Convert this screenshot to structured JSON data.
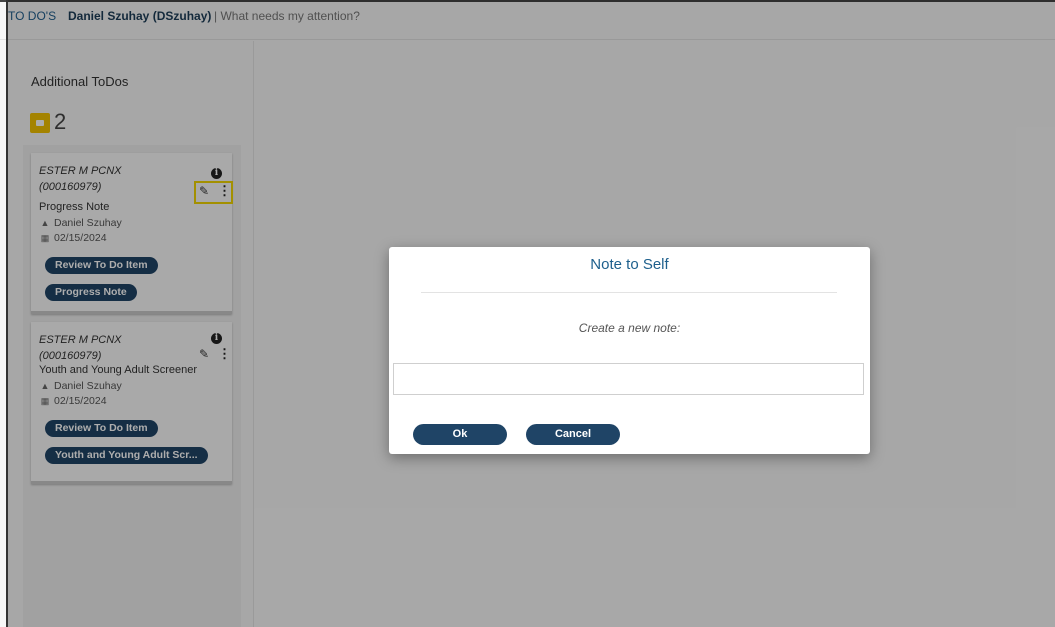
{
  "header": {
    "section": "TO DO'S",
    "user": "Daniel Szuhay (DSzuhay)",
    "subtitle": "| What needs my attention?"
  },
  "sidebar": {
    "heading": "Additional ToDos",
    "folder_count": "2",
    "cards": [
      {
        "client_name": "ESTER M PCNX",
        "client_id": "(000160979)",
        "item_type": "Progress Note",
        "user_icon": "user-icon",
        "user": "Daniel Szuhay",
        "date_icon": "calendar-icon",
        "date": "02/15/2024",
        "buttons": [
          "Review To Do Item",
          "Progress Note"
        ]
      },
      {
        "client_name": "ESTER M PCNX",
        "client_id": "(000160979)",
        "item_type": "Youth and Young Adult Screener",
        "user_icon": "user-icon",
        "user": "Daniel Szuhay",
        "date_icon": "calendar-icon",
        "date": "02/15/2024",
        "buttons": [
          "Review To Do Item",
          "Youth and Young Adult Scr..."
        ]
      }
    ],
    "highlight_color": "#f0d400"
  },
  "modal": {
    "title": "Note to Self",
    "prompt": "Create a new note:",
    "input_value": "",
    "ok_label": "Ok",
    "cancel_label": "Cancel"
  },
  "colors": {
    "accent": "#1d5f8c",
    "button": "#1f4466",
    "folder": "#f2c200"
  }
}
